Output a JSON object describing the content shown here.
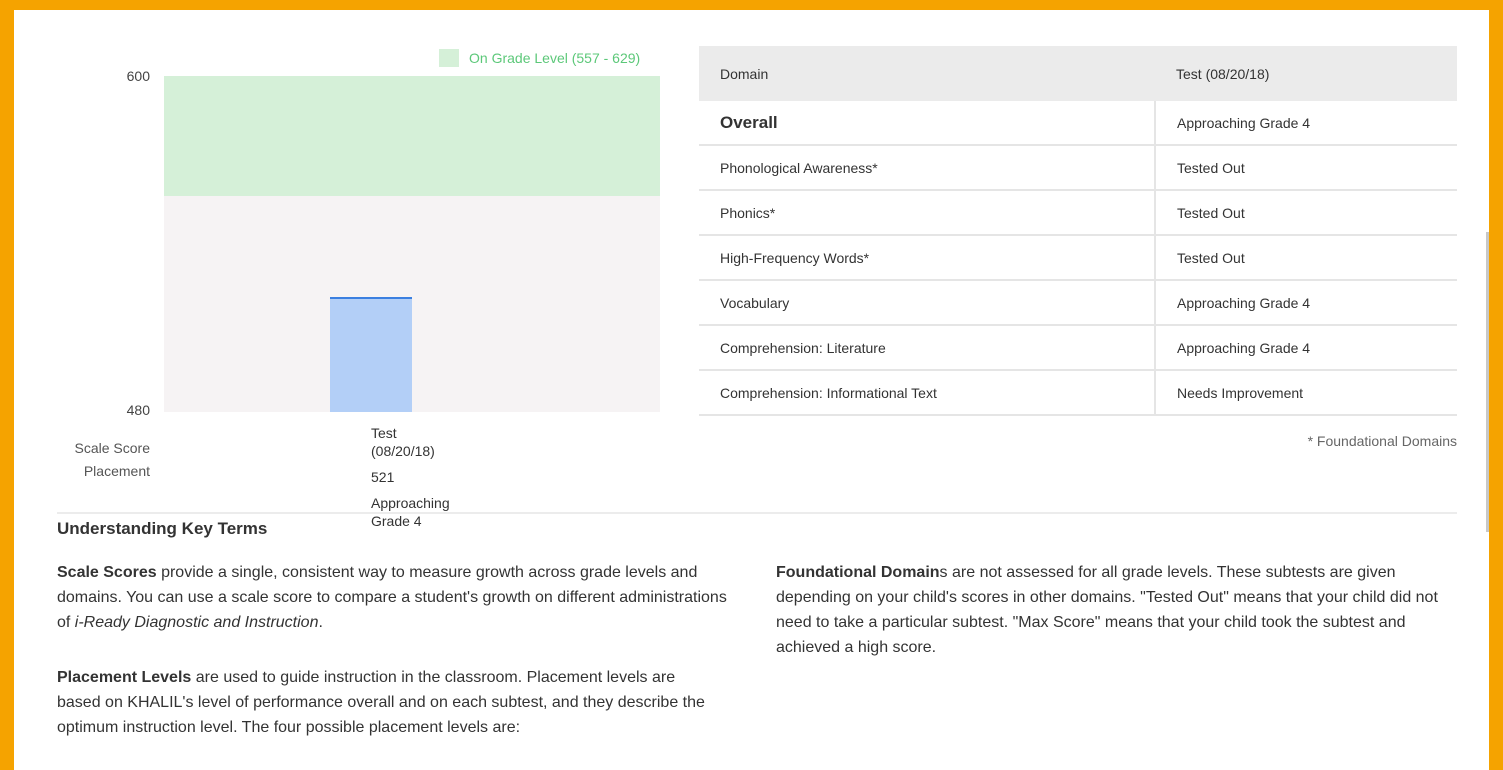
{
  "chart_data": {
    "type": "bar",
    "categories": [
      "Test (08/20/18)"
    ],
    "values": [
      521
    ],
    "ylim": [
      480,
      600
    ],
    "y_ticks": [
      "600",
      "480"
    ],
    "band": {
      "label": "On Grade Level (557 - 629)",
      "from": 557,
      "to": 629,
      "color": "#d5f0d8"
    },
    "bar_color": "#b3cff7",
    "grid": false,
    "legend_position": "top-right"
  },
  "chart_labels": {
    "legend": "On Grade Level (557 - 629)",
    "y_top": "600",
    "y_bottom": "480",
    "row_scale_score": "Scale Score",
    "row_placement": "Placement",
    "test_name": "Test",
    "test_date": "(08/20/18)",
    "scale_score": "521",
    "placement": "Approaching Grade 4"
  },
  "table": {
    "header_domain": "Domain",
    "header_test": "Test (08/20/18)",
    "rows": [
      {
        "domain": "Overall",
        "value": "Approaching Grade 4"
      },
      {
        "domain": "Phonological Awareness*",
        "value": "Tested Out"
      },
      {
        "domain": "Phonics*",
        "value": "Tested Out"
      },
      {
        "domain": "High-Frequency Words*",
        "value": "Tested Out"
      },
      {
        "domain": "Vocabulary",
        "value": "Approaching Grade 4"
      },
      {
        "domain": "Comprehension: Literature",
        "value": "Approaching Grade 4"
      },
      {
        "domain": "Comprehension: Informational Text",
        "value": "Needs Improvement"
      }
    ],
    "footnote": "* Foundational Domains"
  },
  "key_terms": {
    "title": "Understanding Key Terms",
    "scale_scores_term": "Scale Scores",
    "scale_scores_text": " provide a single, consistent way to measure growth across grade levels and domains. You can use a scale score to compare a student's growth on different administrations of ",
    "scale_scores_product": "i-Ready Diagnostic and Instruction",
    "scale_scores_end": ".",
    "placement_term": "Placement Levels",
    "placement_text": " are used to guide instruction in the classroom. Placement levels are based on KHALIL's level of performance overall and on each subtest, and they describe the optimum instruction level. The four possible placement levels are:",
    "foundational_term": "Foundational Domain",
    "foundational_suffix": "s",
    "foundational_text": " are not assessed for all grade levels. These subtests are given depending on your child's scores in other domains. \"Tested Out\" means that your child did not need to take a particular subtest. \"Max Score\" means that your child took the subtest and achieved a high score."
  }
}
